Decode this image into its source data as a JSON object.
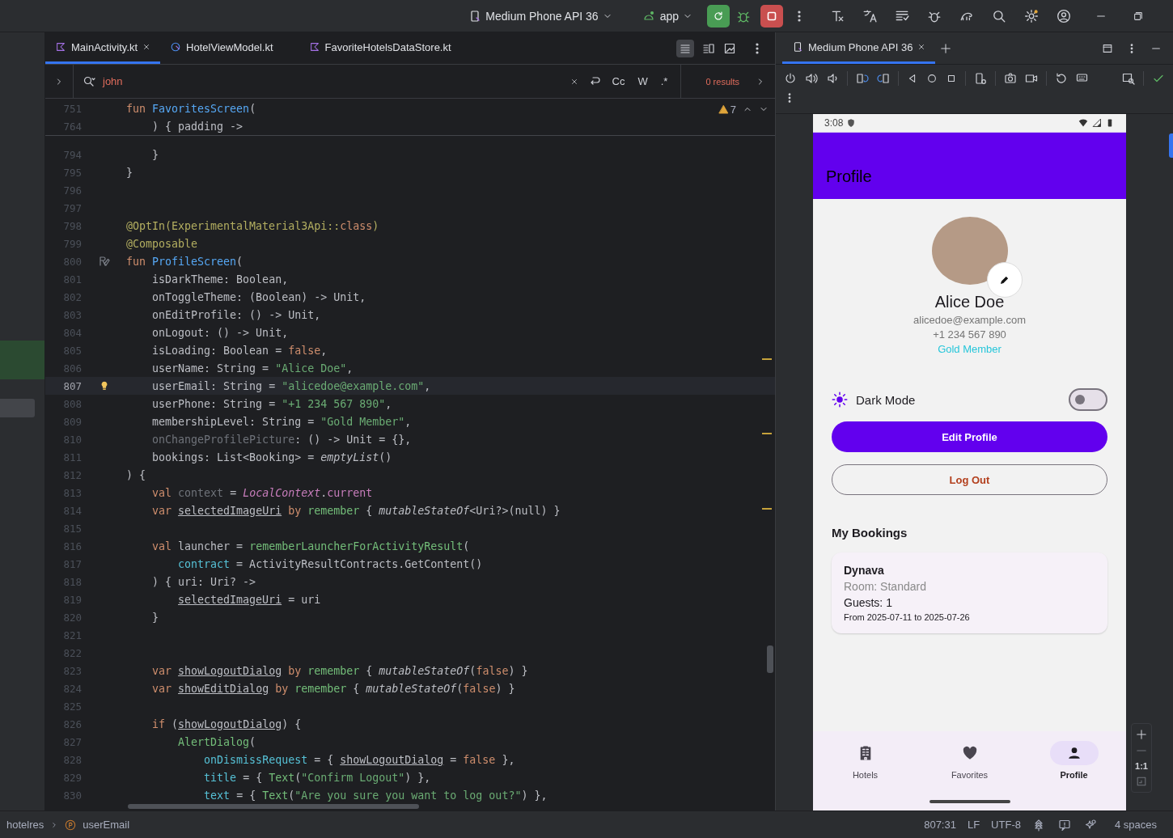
{
  "top_bar": {
    "device": "Medium Phone API 36",
    "run_config": "app"
  },
  "editor": {
    "tabs": [
      {
        "label": "MainActivity.kt",
        "selected": true,
        "kind": "kotlin"
      },
      {
        "label": "HotelViewModel.kt",
        "selected": false,
        "kind": "compose"
      },
      {
        "label": "FavoriteHotelsDataStore.kt",
        "selected": false,
        "kind": "kotlin"
      }
    ],
    "search": {
      "value": "john",
      "options": [
        "Cc",
        "W",
        ".*"
      ],
      "result": "0 results"
    },
    "inspections": {
      "count": "7"
    },
    "sticky_lines": [
      {
        "number": "751",
        "current": false,
        "tokens": [
          {
            "kind": "kw",
            "text": "fun "
          },
          {
            "kind": "fn",
            "text": "FavoritesScreen"
          },
          {
            "kind": "p",
            "text": "("
          }
        ]
      },
      {
        "number": "764",
        "current": false,
        "tokens": [
          {
            "kind": "p",
            "text": "    ) { padding ->"
          }
        ]
      }
    ],
    "lines": [
      {
        "number": "794",
        "current": false,
        "tokens": [
          {
            "kind": "p",
            "text": "    }"
          }
        ]
      },
      {
        "number": "795",
        "current": false,
        "tokens": [
          {
            "kind": "p",
            "text": "}"
          }
        ]
      },
      {
        "number": "796",
        "current": false
      },
      {
        "number": "797",
        "current": false
      },
      {
        "number": "798",
        "current": false,
        "tokens": [
          {
            "kind": "ann",
            "text": "@OptIn(ExperimentalMaterial3Api::"
          },
          {
            "kind": "kw",
            "text": "class"
          },
          {
            "kind": "ann",
            "text": ")"
          }
        ]
      },
      {
        "number": "799",
        "current": false,
        "tokens": [
          {
            "kind": "ann",
            "text": "@Composable"
          }
        ]
      },
      {
        "number": "800",
        "current": false,
        "gutter": {
          "kind": "preview"
        },
        "tokens": [
          {
            "kind": "kw",
            "text": "fun "
          },
          {
            "kind": "fn",
            "text": "ProfileScreen"
          },
          {
            "kind": "p",
            "text": "("
          }
        ]
      },
      {
        "number": "801",
        "current": false,
        "tokens": [
          {
            "kind": "p",
            "text": "    isDarkTheme: Boolean,"
          }
        ]
      },
      {
        "number": "802",
        "current": false,
        "tokens": [
          {
            "kind": "p",
            "text": "    onToggleTheme: (Boolean) -> Unit,"
          }
        ]
      },
      {
        "number": "803",
        "current": false,
        "tokens": [
          {
            "kind": "p",
            "text": "    onEditProfile: () -> Unit,"
          }
        ]
      },
      {
        "number": "804",
        "current": false,
        "tokens": [
          {
            "kind": "p",
            "text": "    onLogout: () -> Unit,"
          }
        ]
      },
      {
        "number": "805",
        "current": false,
        "tokens": [
          {
            "kind": "p",
            "text": "    isLoading: Boolean = "
          },
          {
            "kind": "kw",
            "text": "false"
          },
          {
            "kind": "p",
            "text": ","
          }
        ]
      },
      {
        "number": "806",
        "current": false,
        "tokens": [
          {
            "kind": "p",
            "text": "    userName: String = "
          },
          {
            "kind": "str",
            "text": "\"Alice Doe\""
          },
          {
            "kind": "p",
            "text": ","
          }
        ]
      },
      {
        "number": "807",
        "current": true,
        "gutter": {
          "kind": "bulb"
        },
        "tokens": [
          {
            "kind": "p",
            "text": "    userEmail: String = "
          },
          {
            "kind": "str",
            "text": "\"alicedoe@example.com\""
          },
          {
            "kind": "p",
            "text": ","
          }
        ]
      },
      {
        "number": "808",
        "current": false,
        "tokens": [
          {
            "kind": "p",
            "text": "    userPhone: String = "
          },
          {
            "kind": "str",
            "text": "\"+1 234 567 890\""
          },
          {
            "kind": "p",
            "text": ","
          }
        ]
      },
      {
        "number": "809",
        "current": false,
        "tokens": [
          {
            "kind": "p",
            "text": "    membershipLevel: String = "
          },
          {
            "kind": "str",
            "text": "\"Gold Member\""
          },
          {
            "kind": "p",
            "text": ","
          }
        ]
      },
      {
        "number": "810",
        "current": false,
        "tokens": [
          {
            "kind": "dim",
            "text": "    onChangeProfilePicture"
          },
          {
            "kind": "p",
            "text": ": () -> Unit = {},"
          }
        ]
      },
      {
        "number": "811",
        "current": false,
        "tokens": [
          {
            "kind": "p",
            "text": "    bookings: List<Booking> = "
          },
          {
            "kind": "it",
            "text": "emptyList"
          },
          {
            "kind": "p",
            "text": "()"
          }
        ]
      },
      {
        "number": "812",
        "current": false,
        "tokens": [
          {
            "kind": "p",
            "text": ") {"
          }
        ]
      },
      {
        "number": "813",
        "current": false,
        "tokens": [
          {
            "kind": "kw",
            "text": "    val "
          },
          {
            "kind": "dim",
            "text": "context"
          },
          {
            "kind": "p",
            "text": " = "
          },
          {
            "kind": "loc",
            "text": "LocalContext"
          },
          {
            "kind": "p",
            "text": "."
          },
          {
            "kind": "prop",
            "text": "current"
          }
        ]
      },
      {
        "number": "814",
        "current": false,
        "tokens": [
          {
            "kind": "kw",
            "text": "    var "
          },
          {
            "kind": "u",
            "text": "selectedImageUri"
          },
          {
            "kind": "kw",
            "text": " by "
          },
          {
            "kind": "call",
            "text": "remember"
          },
          {
            "kind": "p",
            "text": " { "
          },
          {
            "kind": "it",
            "text": "mutableStateOf"
          },
          {
            "kind": "p",
            "text": "<Uri?>(null) }"
          }
        ]
      },
      {
        "number": "815",
        "current": false
      },
      {
        "number": "816",
        "current": false,
        "tokens": [
          {
            "kind": "kw",
            "text": "    val "
          },
          {
            "kind": "p",
            "text": "launcher = "
          },
          {
            "kind": "call",
            "text": "rememberLauncherForActivityResult"
          },
          {
            "kind": "p",
            "text": "("
          }
        ]
      },
      {
        "number": "817",
        "current": false,
        "tokens": [
          {
            "kind": "named",
            "text": "        contract"
          },
          {
            "kind": "p",
            "text": " = ActivityResultContracts.GetContent()"
          }
        ]
      },
      {
        "number": "818",
        "current": false,
        "tokens": [
          {
            "kind": "p",
            "text": "    ) { uri: Uri? ->"
          }
        ]
      },
      {
        "number": "819",
        "current": false,
        "tokens": [
          {
            "kind": "u",
            "text": "        selectedImageUri"
          },
          {
            "kind": "p",
            "text": " = uri"
          }
        ]
      },
      {
        "number": "820",
        "current": false,
        "tokens": [
          {
            "kind": "p",
            "text": "    }"
          }
        ]
      },
      {
        "number": "821",
        "current": false
      },
      {
        "number": "822",
        "current": false
      },
      {
        "number": "823",
        "current": false,
        "tokens": [
          {
            "kind": "kw",
            "text": "    var "
          },
          {
            "kind": "u",
            "text": "showLogoutDialog"
          },
          {
            "kind": "kw",
            "text": " by "
          },
          {
            "kind": "call",
            "text": "remember"
          },
          {
            "kind": "p",
            "text": " { "
          },
          {
            "kind": "it",
            "text": "mutableStateOf"
          },
          {
            "kind": "p",
            "text": "("
          },
          {
            "kind": "kw",
            "text": "false"
          },
          {
            "kind": "p",
            "text": ") }"
          }
        ]
      },
      {
        "number": "824",
        "current": false,
        "tokens": [
          {
            "kind": "kw",
            "text": "    var "
          },
          {
            "kind": "u",
            "text": "showEditDialog"
          },
          {
            "kind": "kw",
            "text": " by "
          },
          {
            "kind": "call",
            "text": "remember"
          },
          {
            "kind": "p",
            "text": " { "
          },
          {
            "kind": "it",
            "text": "mutableStateOf"
          },
          {
            "kind": "p",
            "text": "("
          },
          {
            "kind": "kw",
            "text": "false"
          },
          {
            "kind": "p",
            "text": ") }"
          }
        ]
      },
      {
        "number": "825",
        "current": false
      },
      {
        "number": "826",
        "current": false,
        "tokens": [
          {
            "kind": "kw",
            "text": "    if "
          },
          {
            "kind": "p",
            "text": "("
          },
          {
            "kind": "u",
            "text": "showLogoutDialog"
          },
          {
            "kind": "p",
            "text": ") {"
          }
        ]
      },
      {
        "number": "827",
        "current": false,
        "tokens": [
          {
            "kind": "call",
            "text": "        AlertDialog"
          },
          {
            "kind": "p",
            "text": "("
          }
        ]
      },
      {
        "number": "828",
        "current": false,
        "tokens": [
          {
            "kind": "named",
            "text": "            onDismissRequest"
          },
          {
            "kind": "p",
            "text": " = { "
          },
          {
            "kind": "u",
            "text": "showLogoutDialog"
          },
          {
            "kind": "p",
            "text": " = "
          },
          {
            "kind": "kw",
            "text": "false"
          },
          {
            "kind": "p",
            "text": " },"
          }
        ]
      },
      {
        "number": "829",
        "current": false,
        "tokens": [
          {
            "kind": "named",
            "text": "            title"
          },
          {
            "kind": "p",
            "text": " = { "
          },
          {
            "kind": "call",
            "text": "Text"
          },
          {
            "kind": "p",
            "text": "("
          },
          {
            "kind": "str",
            "text": "\"Confirm Logout\""
          },
          {
            "kind": "p",
            "text": ") },"
          }
        ]
      },
      {
        "number": "830",
        "current": false,
        "tokens": [
          {
            "kind": "named",
            "text": "            text"
          },
          {
            "kind": "p",
            "text": " = { "
          },
          {
            "kind": "call",
            "text": "Text"
          },
          {
            "kind": "p",
            "text": "("
          },
          {
            "kind": "str",
            "text": "\"Are you sure you want to log out?\""
          },
          {
            "kind": "p",
            "text": ") },"
          }
        ]
      }
    ]
  },
  "emulator": {
    "tab": "Medium Phone API 36",
    "zoom_label": "1:1",
    "phone": {
      "time": "3:08",
      "app_title": "Profile",
      "profile": {
        "name": "Alice Doe",
        "email": "alicedoe@example.com",
        "phone": "+1 234 567 890",
        "membership": "Gold Member"
      },
      "dark_mode": {
        "label": "Dark Mode",
        "on": false
      },
      "buttons": [
        {
          "label": "Edit Profile",
          "kind": "filled"
        },
        {
          "label": "Log Out",
          "kind": "outlined"
        }
      ],
      "bookings": {
        "title": "My Bookings",
        "items": [
          {
            "hotel": "Dynava",
            "room": "Room: Standard",
            "guests": "Guests: 1",
            "dates": "From 2025-07-11 to 2025-07-26"
          }
        ]
      },
      "nav": [
        {
          "label": "Hotels",
          "kind": "hotel",
          "selected": false
        },
        {
          "label": "Favorites",
          "kind": "heart",
          "selected": false
        },
        {
          "label": "Profile",
          "kind": "person",
          "selected": true
        }
      ]
    }
  },
  "status_bar": {
    "breadcrumbs": [
      {
        "label": "hotelres",
        "kind": "module"
      },
      {
        "label": "userEmail",
        "kind": "property"
      }
    ],
    "position": "807:31",
    "line_ending": "LF",
    "encoding": "UTF-8",
    "indent": "4 spaces"
  }
}
